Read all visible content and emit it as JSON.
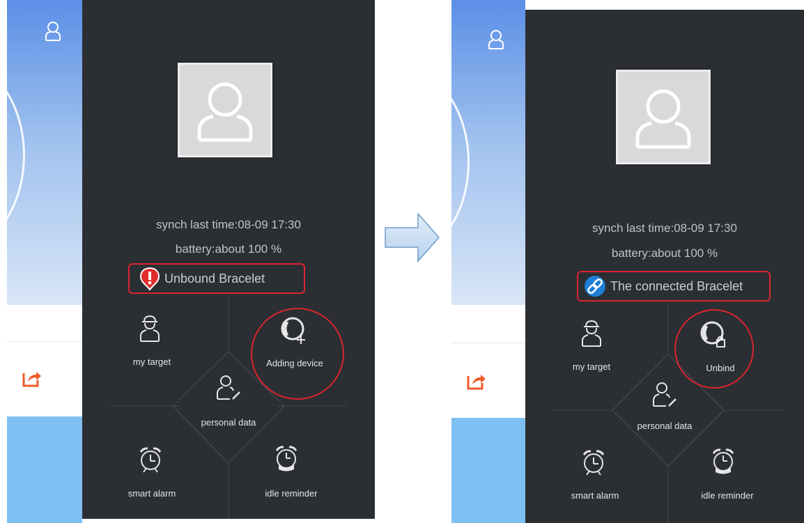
{
  "left": {
    "sync_text": "synch last time:08-09 17:30",
    "battery_text": "battery:about 100 %",
    "status_text": "Unbound Bracelet",
    "status_icon": "alert-icon",
    "menu": {
      "my_target": "my target",
      "device": "Adding device",
      "personal_data": "personal data",
      "smart_alarm": "smart alarm",
      "idle_reminder": "idle reminder"
    }
  },
  "right": {
    "sync_text": "synch last time:08-09 17:30",
    "battery_text": "battery:about 100 %",
    "status_text": "The connected Bracelet",
    "status_icon": "link-icon",
    "menu": {
      "my_target": "my target",
      "device": "Unbind",
      "personal_data": "personal data",
      "smart_alarm": "smart alarm",
      "idle_reminder": "idle reminder"
    }
  },
  "colors": {
    "panel_bg": "#2b2e33",
    "highlight": "#d9252e",
    "share_icon": "#f05a28"
  }
}
